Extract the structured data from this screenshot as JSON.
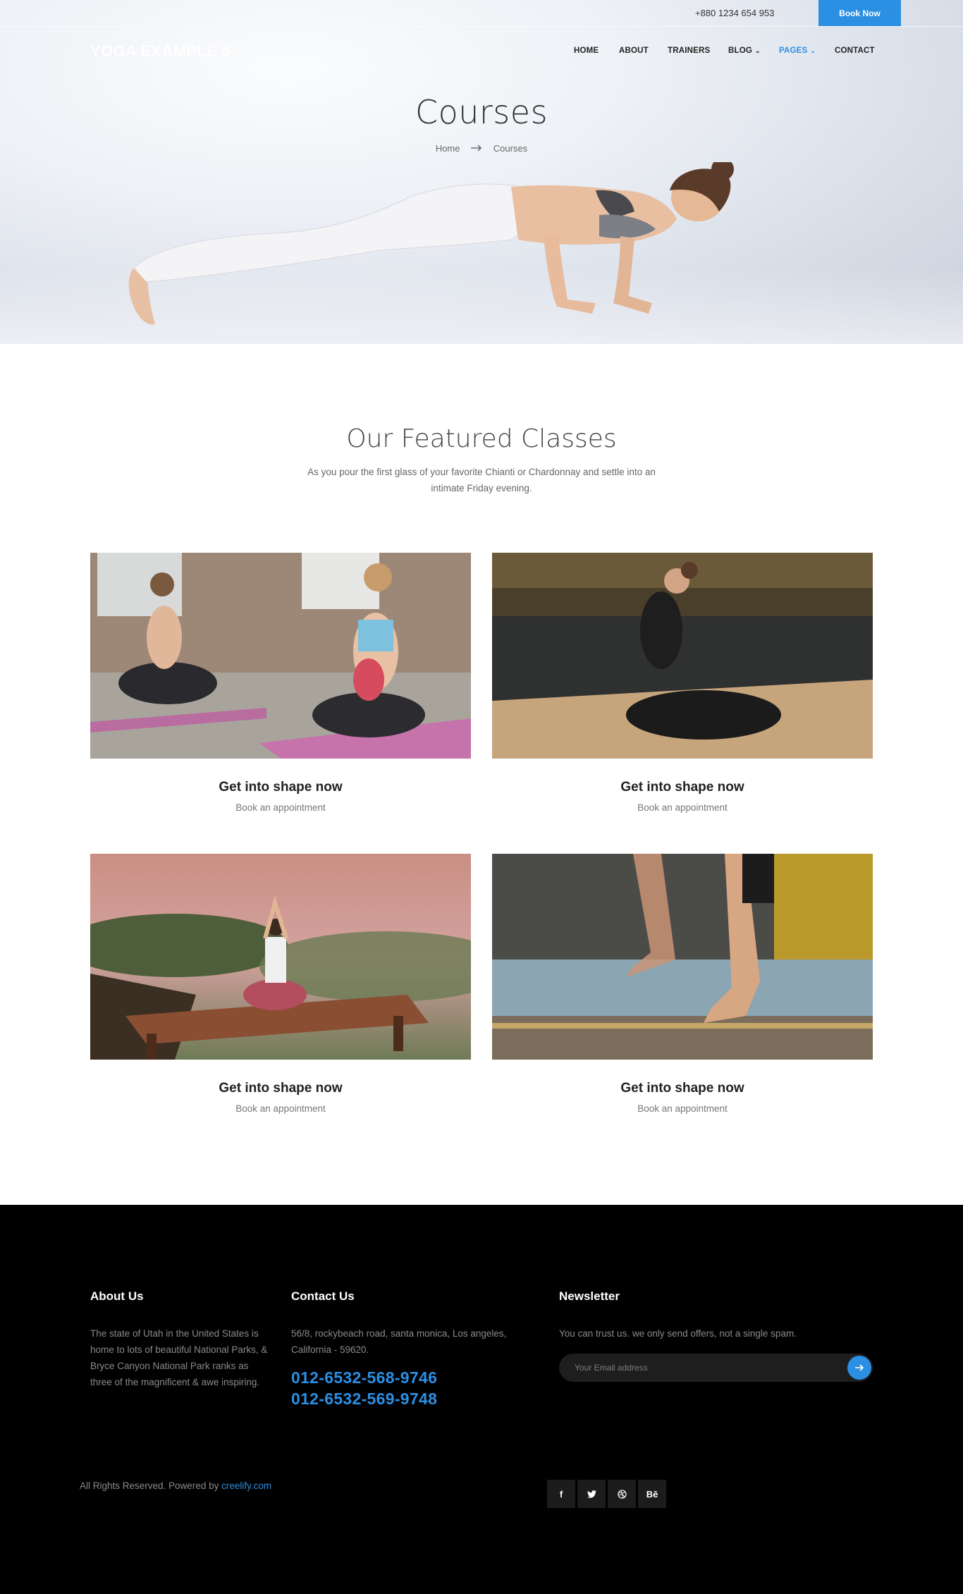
{
  "topbar": {
    "phone": "+880 1234 654 953",
    "book_label": "Book Now"
  },
  "header": {
    "logo": "YOGA EXAMPLE 5",
    "nav": [
      {
        "label": "HOME"
      },
      {
        "label": "ABOUT"
      },
      {
        "label": "TRAINERS"
      },
      {
        "label": "BLOG"
      },
      {
        "label": "PAGES"
      },
      {
        "label": "CONTACT"
      }
    ],
    "nav_active": "PAGES",
    "accent_color": "#2b8fe3"
  },
  "hero": {
    "title": "Courses",
    "breadcrumb": {
      "home": "Home",
      "separator_icon": "arrow-right-icon",
      "current": "Courses"
    }
  },
  "featured": {
    "title": "Our Featured Classes",
    "description": "As you pour the first glass of your favorite Chianti or Chardonnay and settle into an intimate Friday evening.",
    "cards": [
      {
        "title": "Get into shape now",
        "subtitle": "Book an appointment"
      },
      {
        "title": "Get into shape now",
        "subtitle": "Book an appointment"
      },
      {
        "title": "Get into shape now",
        "subtitle": "Book an appointment"
      },
      {
        "title": "Get into shape now",
        "subtitle": "Book an appointment"
      }
    ]
  },
  "footer": {
    "about": {
      "heading": "About Us",
      "text": "The state of Utah in the United States is home to lots of beautiful National Parks, & Bryce Canyon National Park ranks as three of the magnificent & awe inspiring."
    },
    "contact": {
      "heading": "Contact Us",
      "address": "56/8, rockybeach road, santa monica, Los angeles, California - 59620.",
      "phones": [
        "012-6532-568-9746",
        "012-6532-569-9748"
      ]
    },
    "newsletter": {
      "heading": "Newsletter",
      "text": "You can trust us. we only send offers, not a single spam.",
      "placeholder": "Your Email address"
    },
    "copyright_prefix": "All Rights Reserved. Powered by",
    "copyright_link": "creelify.com",
    "socials": [
      {
        "icon": "facebook-icon",
        "glyph": "f"
      },
      {
        "icon": "twitter-icon",
        "glyph": ""
      },
      {
        "icon": "dribbble-icon",
        "glyph": ""
      },
      {
        "icon": "behance-icon",
        "glyph": "Bē"
      }
    ]
  }
}
